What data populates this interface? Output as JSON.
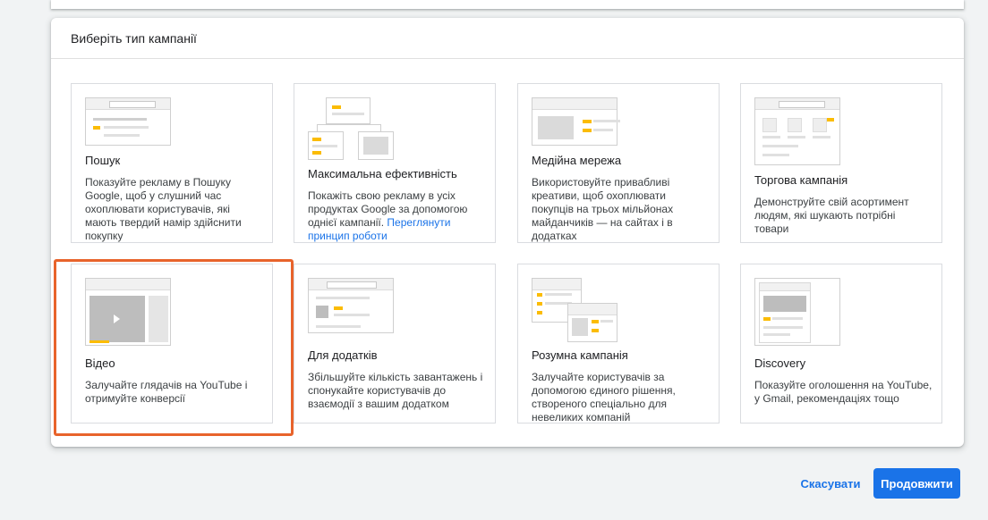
{
  "dialog": {
    "title": "Виберіть тип кампанії"
  },
  "cards": [
    {
      "title": "Пошук",
      "description": "Показуйте рекламу в Пошуку Google, щоб у слушний час охоплювати користувачів, які мають твердий намір здійснити покупку"
    },
    {
      "title": "Максимальна ефективність",
      "description": "Покажіть свою рекламу в усіх продуктах Google за допомогою однієї кампанії.",
      "link": "Переглянути принцип роботи"
    },
    {
      "title": "Медійна мережа",
      "description": "Використовуйте привабливі креативи, щоб охоплювати покупців на трьох мільйонах майданчиків — на сайтах і в додатках"
    },
    {
      "title": "Торгова кампанія",
      "description": "Демонструйте свій асортимент людям, які шукають потрібні товари"
    },
    {
      "title": "Відео",
      "description": "Залучайте глядачів на YouTube і отримуйте конверсії"
    },
    {
      "title": "Для додатків",
      "description": "Збільшуйте кількість завантажень і спонукайте користувачів до взаємодії з вашим додатком"
    },
    {
      "title": "Розумна кампанія",
      "description": "Залучайте користувачів за допомогою єдиного рішення, створеного спеціально для невеликих компаній"
    },
    {
      "title": "Discovery",
      "description": "Показуйте оголошення на YouTube, у Gmail, рекомендаціях тощо"
    }
  ],
  "actions": {
    "cancel": "Скасувати",
    "continue": "Продовжити"
  },
  "colors": {
    "accent": "#1a73e8",
    "highlight": "#e8632b",
    "illustration_yellow": "#fbbc04"
  }
}
